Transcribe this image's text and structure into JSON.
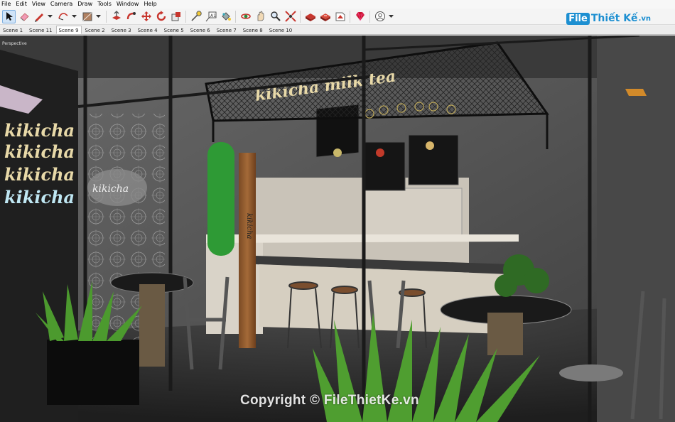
{
  "menu": [
    "File",
    "Edit",
    "View",
    "Camera",
    "Draw",
    "Tools",
    "Window",
    "Help"
  ],
  "toolbar": {
    "tools": [
      "select-icon",
      "eraser-icon",
      "pencil-icon",
      "shape-icon",
      "rectangle-icon",
      "push-pull-icon",
      "follow-me-icon",
      "move-icon",
      "rotate-icon",
      "scale-icon",
      "tape-measure-icon",
      "text-icon",
      "paint-bucket-icon",
      "orbit-icon",
      "pan-icon",
      "zoom-icon",
      "zoom-extents-icon",
      "warehouse-icon",
      "extension-warehouse-icon",
      "layout-icon",
      "ruby-icon",
      "account-icon"
    ]
  },
  "brand": {
    "box": "File",
    "name": "Thiết Kế",
    "suffix": ".vn",
    "color": "#1d8fd1"
  },
  "scenes": {
    "tabs": [
      "Scene 1",
      "Scene 11",
      "Scene 9",
      "Scene 2",
      "Scene 3",
      "Scene 4",
      "Scene 5",
      "Scene 6",
      "Scene 7",
      "Scene 8",
      "Scene 10"
    ],
    "active": "Scene 9"
  },
  "viewport": {
    "camera": "Perspective",
    "scene": {
      "wall_sign": [
        "kikicha",
        "kikicha",
        "kikicha",
        "kikicha"
      ],
      "glass_decal": "kikicha",
      "hanging_sign": "kikicha milk tea",
      "door_text": "kikicha"
    },
    "watermark": "Copyright © FileThietKe.vn"
  }
}
